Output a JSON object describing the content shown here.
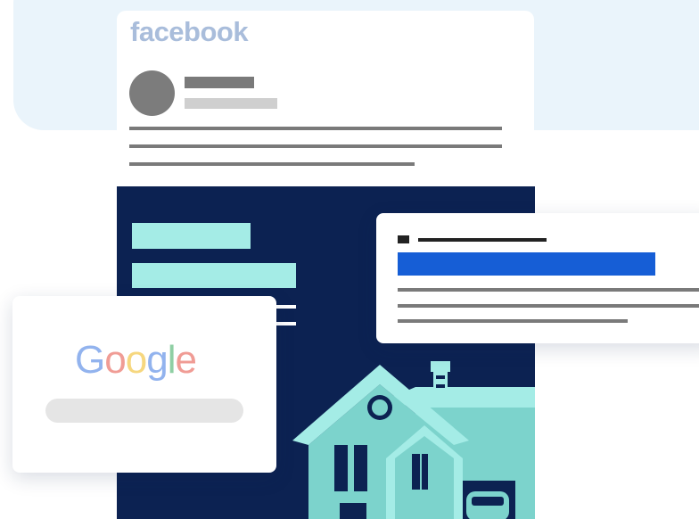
{
  "facebook": {
    "logo_text": "facebook",
    "logo_color": "#a9bddb"
  },
  "google": {
    "letters": [
      {
        "char": "G",
        "color": "#92b3ee"
      },
      {
        "char": "o",
        "color": "#f09c95"
      },
      {
        "char": "o",
        "color": "#f6d77f"
      },
      {
        "char": "g",
        "color": "#92b3ee"
      },
      {
        "char": "l",
        "color": "#8fcfa4"
      },
      {
        "char": "e",
        "color": "#f09c95"
      }
    ]
  },
  "colors": {
    "background_panel": "#eaf4fb",
    "ad_background": "#0c2252",
    "ad_accent": "#a4ece6",
    "result_link": "#165ed6",
    "text_placeholder_dark": "#7a7a7a",
    "text_placeholder_light": "#cfcfcf"
  },
  "icons": {
    "house": "house-illustration",
    "car": "car-illustration"
  }
}
